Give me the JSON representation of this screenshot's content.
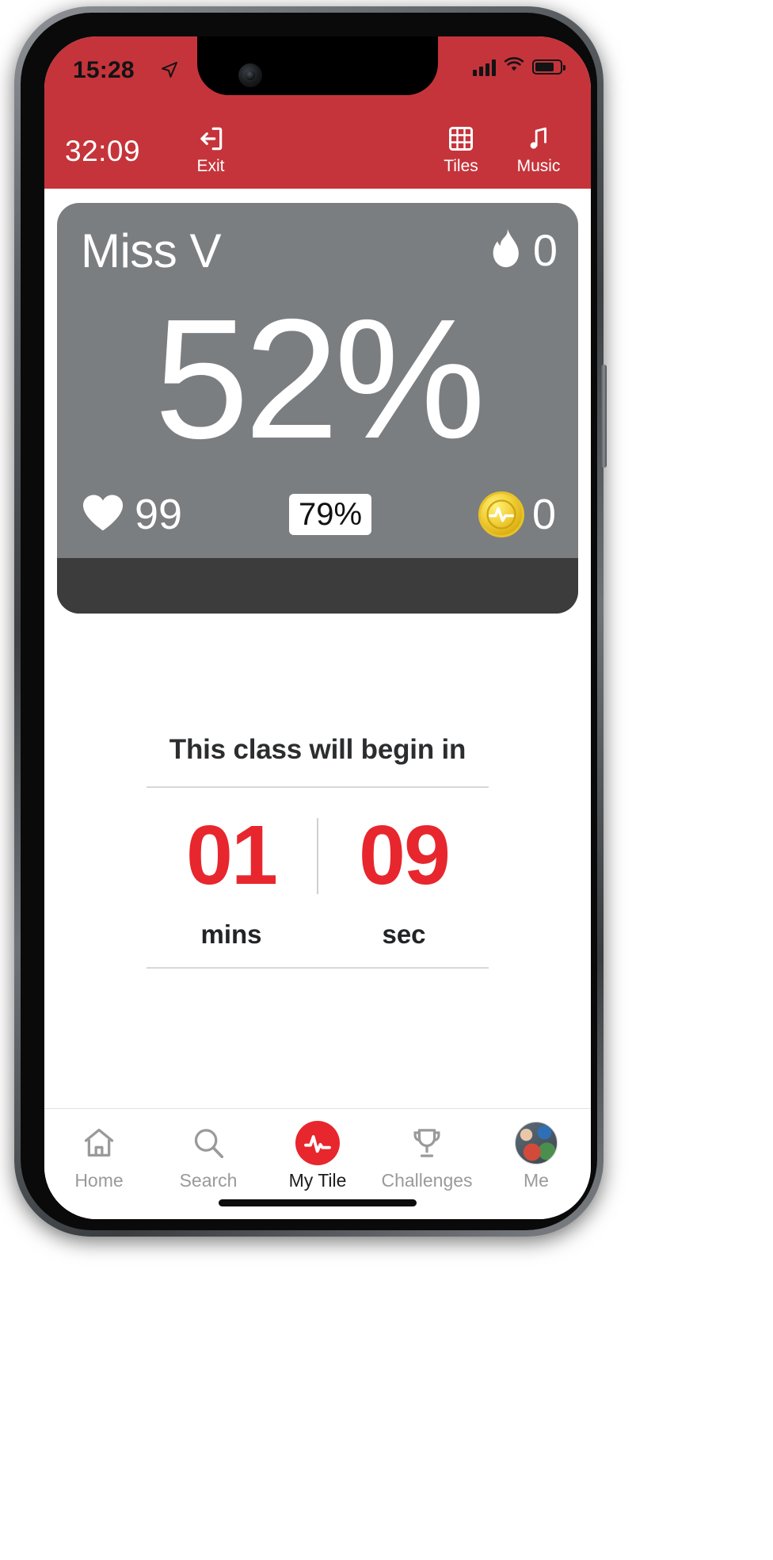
{
  "status_bar": {
    "time": "15:28",
    "location_icon": "location-arrow-icon",
    "signal_icon": "cellular-signal-icon",
    "wifi_icon": "wifi-icon",
    "battery_icon": "battery-icon"
  },
  "toolbar": {
    "elapsed_time": "32:09",
    "exit_label": "Exit",
    "exit_icon": "exit-icon",
    "tiles_label": "Tiles",
    "tiles_icon": "grid-tiles-icon",
    "music_label": "Music",
    "music_icon": "music-note-icon",
    "background_color": "#c5343a"
  },
  "stats_card": {
    "user_name": "Miss V",
    "calories_icon": "flame-icon",
    "calories_value": "0",
    "effort_percent": "52%",
    "heart_icon": "heart-icon",
    "heart_rate": "99",
    "zone_badge": "79%",
    "mep_icon": "mep-coin-icon",
    "mep_value": "0",
    "card_color": "#7b7e81",
    "footer_color": "#3c3c3d"
  },
  "countdown": {
    "title": "This class will begin in",
    "minutes_value": "01",
    "minutes_label": "mins",
    "seconds_value": "09",
    "seconds_label": "sec",
    "accent_color": "#e8262d"
  },
  "tabbar": {
    "items": [
      {
        "label": "Home",
        "icon": "home-icon",
        "active": false
      },
      {
        "label": "Search",
        "icon": "search-icon",
        "active": false
      },
      {
        "label": "My Tile",
        "icon": "heartbeat-badge-icon",
        "active": true
      },
      {
        "label": "Challenges",
        "icon": "trophy-icon",
        "active": false
      },
      {
        "label": "Me",
        "icon": "avatar-icon",
        "active": false
      }
    ]
  }
}
